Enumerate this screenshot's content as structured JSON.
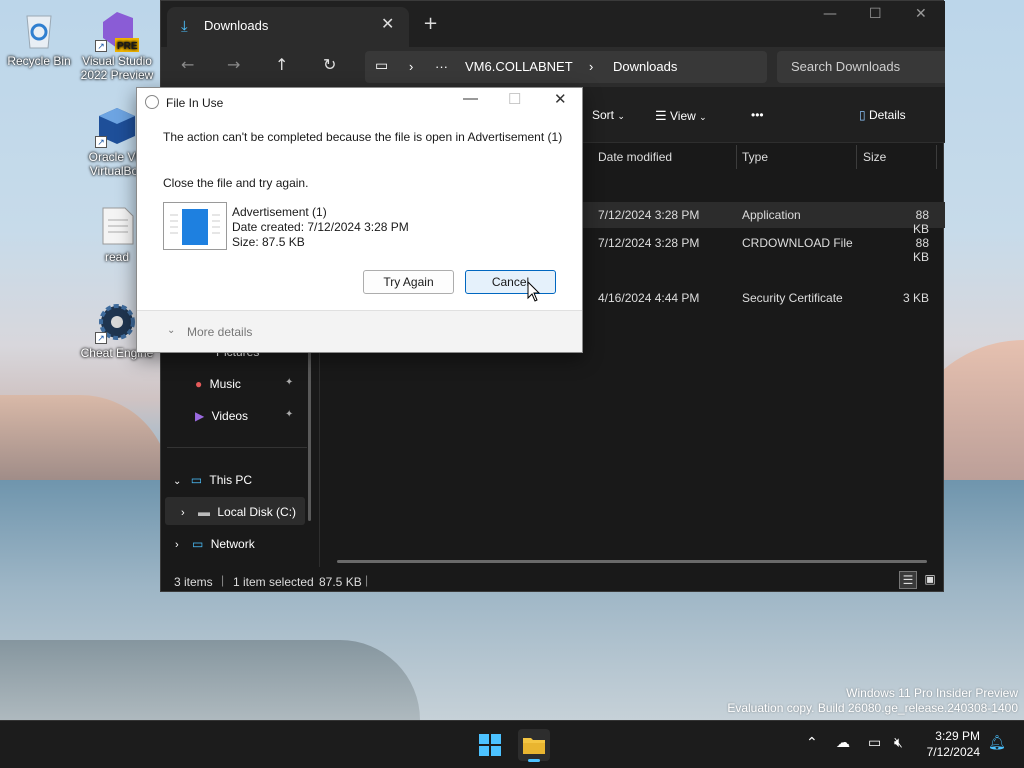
{
  "desktop": {
    "icons": [
      {
        "label": "Recycle Bin"
      },
      {
        "label": "Visual Studio 2022 Preview",
        "badge": "PRE"
      },
      {
        "label": "Oracle VM VirtualBox"
      },
      {
        "label": "read"
      },
      {
        "label": "Cheat Engine"
      }
    ]
  },
  "explorer": {
    "tab_title": "Downloads",
    "breadcrumb": [
      "VM6.COLLABNET",
      "Downloads"
    ],
    "breadcrumb_more": "···",
    "search_placeholder": "Search Downloads",
    "commands": {
      "sort": "Sort",
      "view": "View",
      "more": "•••",
      "details": "Details"
    },
    "columns": [
      "Date modified",
      "Type",
      "Size"
    ],
    "rows": [
      {
        "date": "7/12/2024 3:28 PM",
        "type": "Application",
        "size": "88 KB",
        "selected": true
      },
      {
        "date": "7/12/2024 3:28 PM",
        "type": "CRDOWNLOAD File",
        "size": "88 KB"
      },
      {
        "date": "4/16/2024 4:44 PM",
        "type": "Security Certificate",
        "size": "3 KB"
      }
    ],
    "nav": {
      "pictures": "Pictures",
      "music": "Music",
      "videos": "Videos",
      "this_pc": "This PC",
      "local_disk": "Local Disk (C:)",
      "network": "Network"
    },
    "status": {
      "items": "3 items",
      "selected": "1 item selected",
      "size": "87.5 KB"
    }
  },
  "dialog": {
    "title": "File In Use",
    "message": "The action can't be completed because the file is open in Advertisement (1)",
    "instruction": "Close the file and try again.",
    "file_name": "Advertisement (1)",
    "date_created": "Date created: 7/12/2024 3:28 PM",
    "size": "Size: 87.5 KB",
    "try_again": "Try Again",
    "cancel": "Cancel",
    "more_details": "More details"
  },
  "watermark": {
    "line1": "Windows 11 Pro Insider Preview",
    "line2": "Evaluation copy. Build 26080.ge_release.240308-1400"
  },
  "taskbar": {
    "time": "3:29 PM",
    "date": "7/12/2024"
  },
  "colors": {
    "accent": "#0067c0",
    "explorer_bg": "#191919",
    "folder": "#f4c542",
    "link_blue": "#4cc2ff"
  }
}
